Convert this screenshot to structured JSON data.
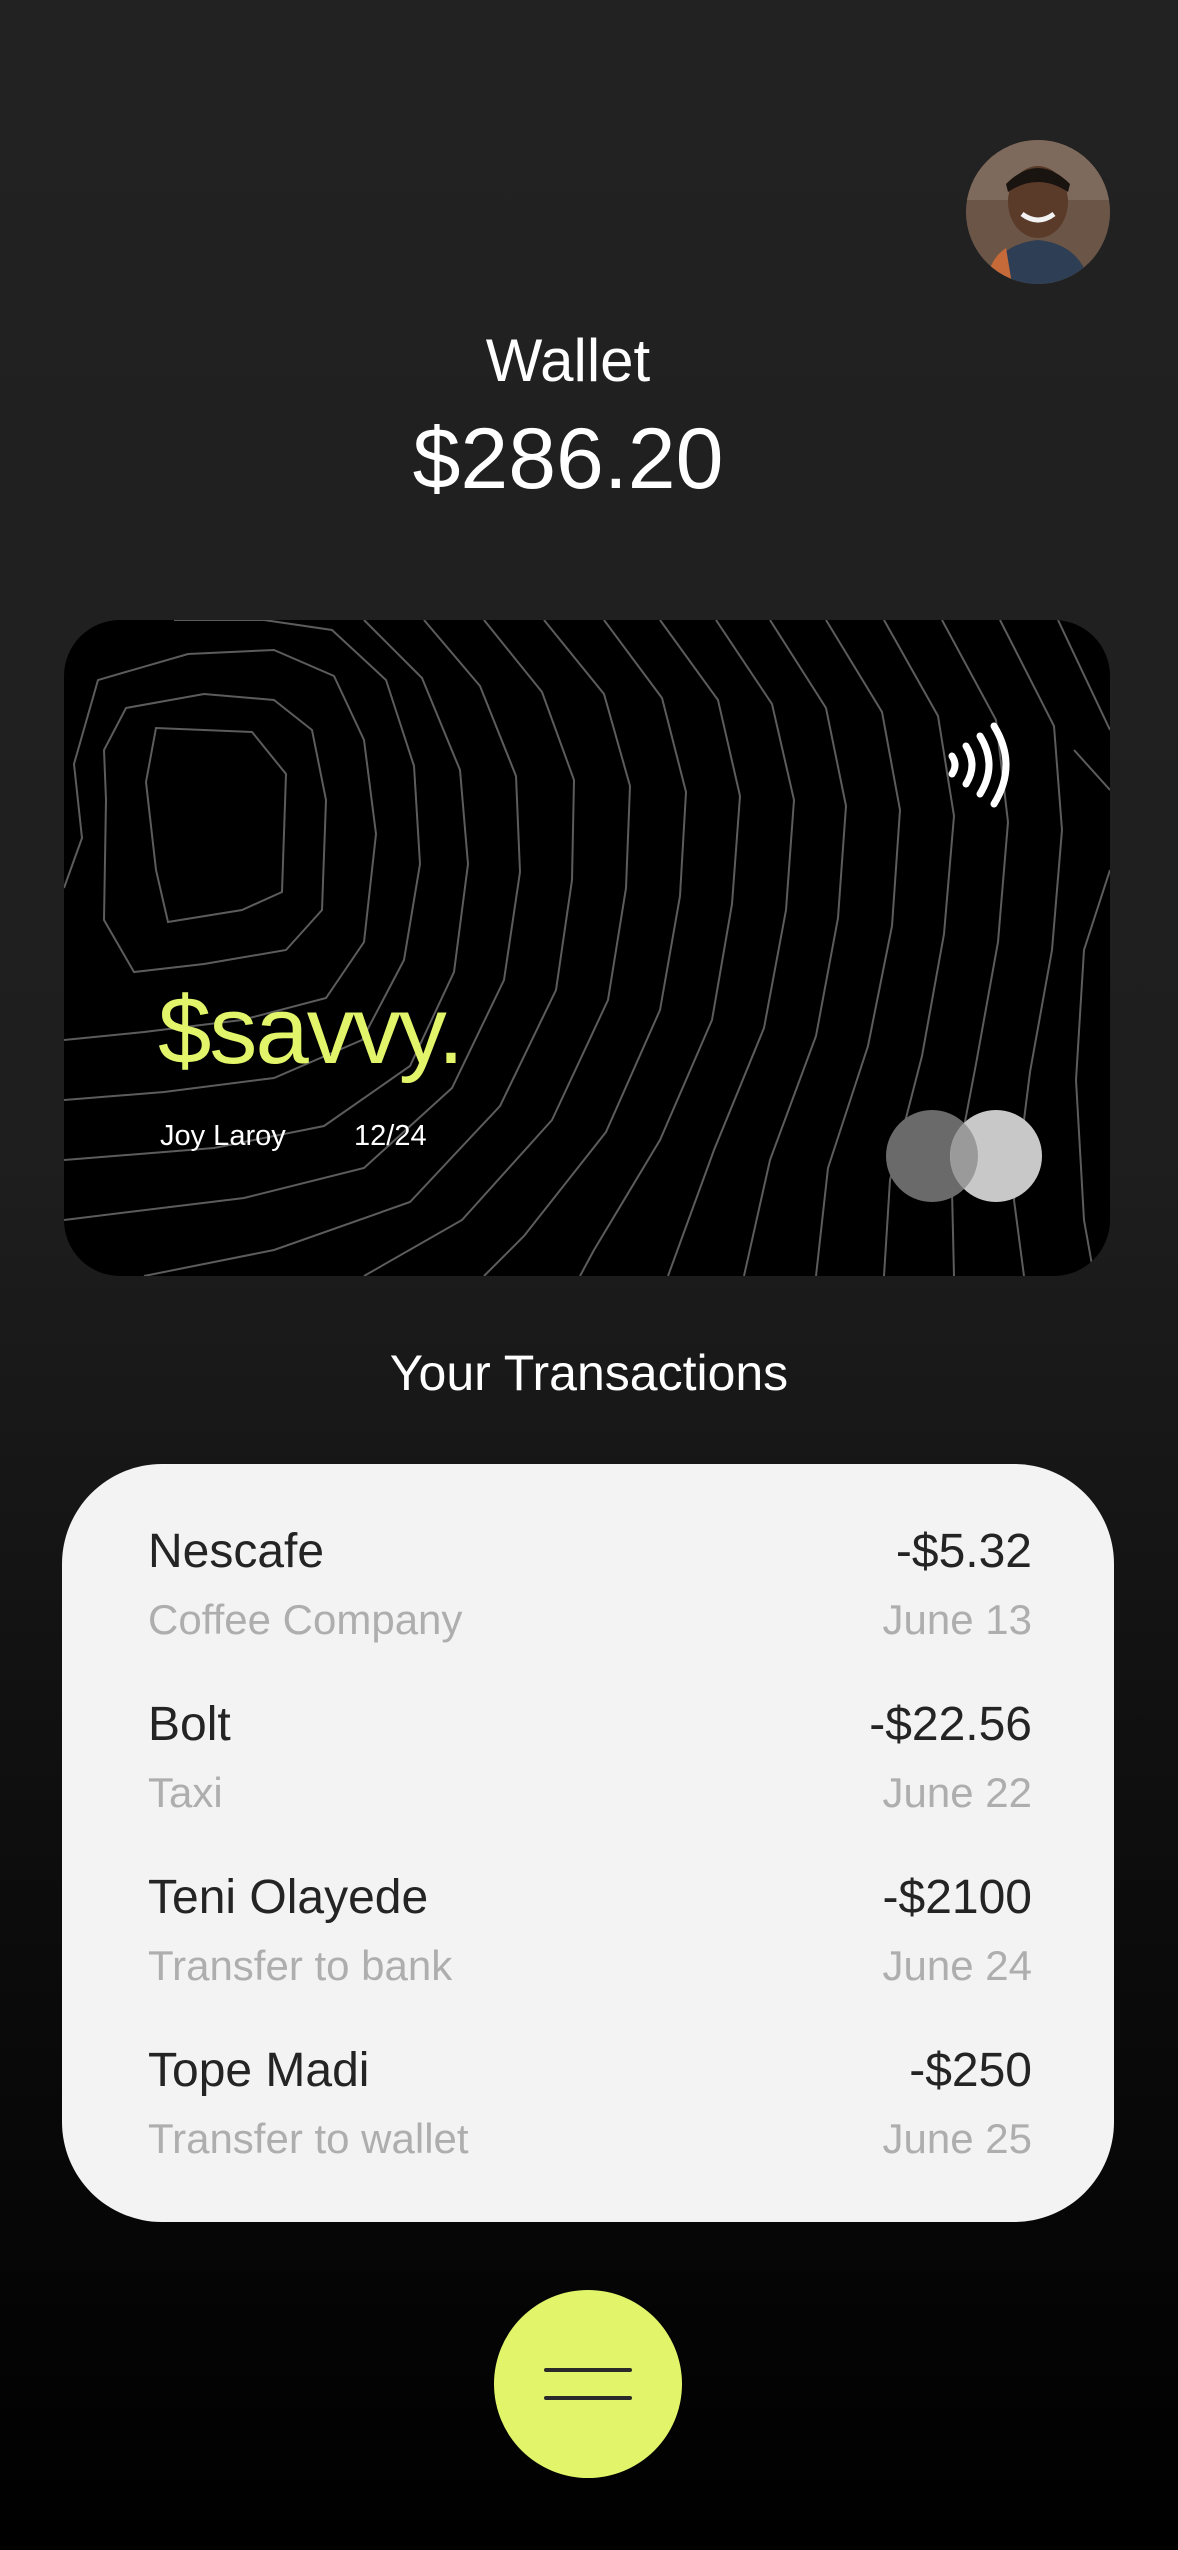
{
  "header": {
    "wallet_label": "Wallet",
    "balance": "$286.20"
  },
  "card": {
    "brand": "$savvy.",
    "holder": "Joy Laroy",
    "expiry": "12/24",
    "brand_color": "#e2f56a"
  },
  "transactions": {
    "title": "Your Transactions",
    "items": [
      {
        "name": "Nescafe",
        "category": "Coffee Company",
        "amount": "-$5.32",
        "date": "June 13"
      },
      {
        "name": "Bolt",
        "category": "Taxi",
        "amount": "-$22.56",
        "date": "June 22"
      },
      {
        "name": "Teni Olayede",
        "category": "Transfer to bank",
        "amount": "-$2100",
        "date": "June 24"
      },
      {
        "name": "Tope Madi",
        "category": "Transfer to wallet",
        "amount": "-$250",
        "date": "June 25"
      }
    ]
  },
  "icons": {
    "profile": "avatar",
    "contactless": "contactless-icon",
    "card_network": "mastercard-logo-icon",
    "menu": "menu-icon"
  },
  "colors": {
    "accent": "#e2f56a",
    "panel": "#f3f3f3",
    "background": "#1e1e1e"
  }
}
